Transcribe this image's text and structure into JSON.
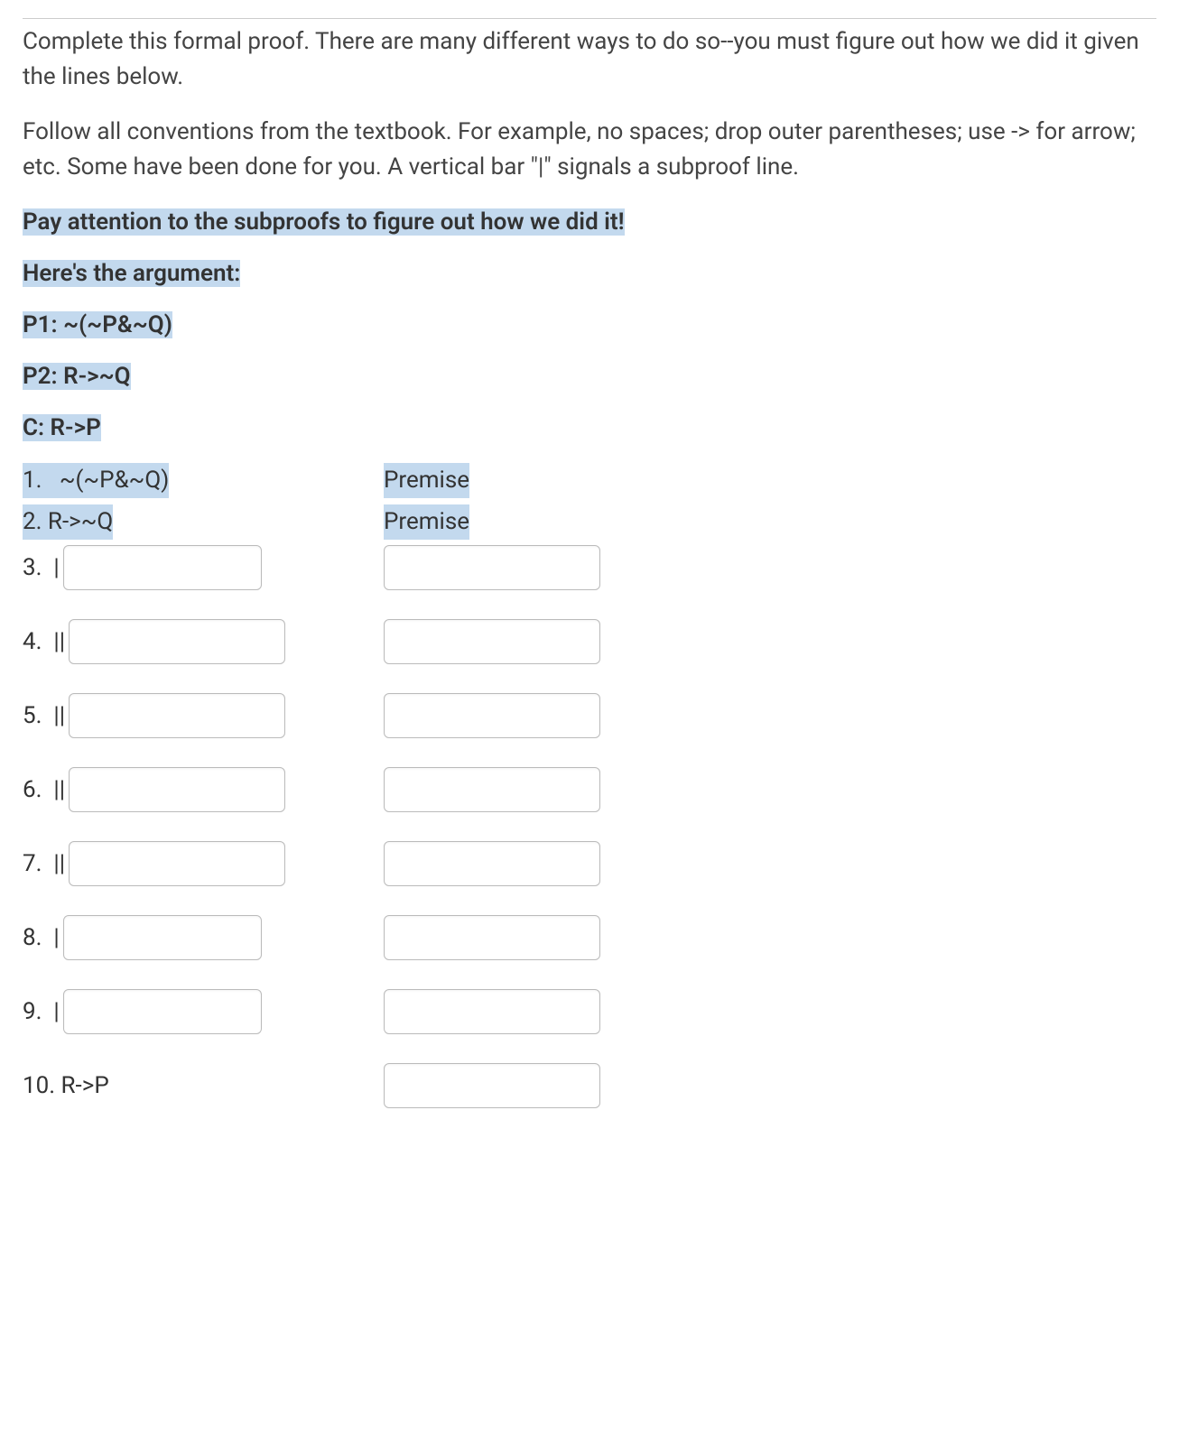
{
  "intro": {
    "para1": "Complete this formal proof. There are many different ways to do so--you must figure out how we did it given the lines below.",
    "para2": "Follow all conventions from the textbook. For example, no spaces; drop outer parentheses; use -> for arrow; etc. Some have been done for you. A vertical bar \"|\" signals a subproof line."
  },
  "highlighted": {
    "attention": "Pay attention to the subproofs to figure out how we did it!",
    "heres_arg": "Here's the argument:",
    "p1": "P1: ~(~P&~Q)",
    "p2": "P2: R->~Q",
    "c": "C: R->P"
  },
  "proof": {
    "rows": [
      {
        "num": "1.",
        "bars": "",
        "formula": "~(~P&~Q)",
        "just": "Premise",
        "formula_hl": true,
        "just_hl": true,
        "input": false,
        "extra_space": "   "
      },
      {
        "num": "2.",
        "bars": "",
        "formula": "R->~Q",
        "just": "Premise",
        "formula_hl": true,
        "just_hl": true,
        "input": false,
        "extra_space": " "
      },
      {
        "num": "3.",
        "bars": "|",
        "formula": "",
        "just": "",
        "input": true,
        "left_width": "narrow"
      },
      {
        "num": "4.",
        "bars": "||",
        "formula": "",
        "just": "",
        "input": true,
        "left_width": "wide"
      },
      {
        "num": "5.",
        "bars": "||",
        "formula": "",
        "just": "",
        "input": true,
        "left_width": "wide"
      },
      {
        "num": "6.",
        "bars": "||",
        "formula": "",
        "just": "",
        "input": true,
        "left_width": "wide"
      },
      {
        "num": "7.",
        "bars": "||",
        "formula": "",
        "just": "",
        "input": true,
        "left_width": "wide"
      },
      {
        "num": "8.",
        "bars": "|",
        "formula": "",
        "just": "",
        "input": true,
        "left_width": "narrow"
      },
      {
        "num": "9.",
        "bars": "|",
        "formula": "",
        "just": "",
        "input": true,
        "left_width": "narrow"
      },
      {
        "num": "10.",
        "bars": "",
        "formula": "R->P",
        "just": "",
        "input": false,
        "formula_hl": false,
        "just_input": true,
        "extra_space": " "
      }
    ]
  }
}
